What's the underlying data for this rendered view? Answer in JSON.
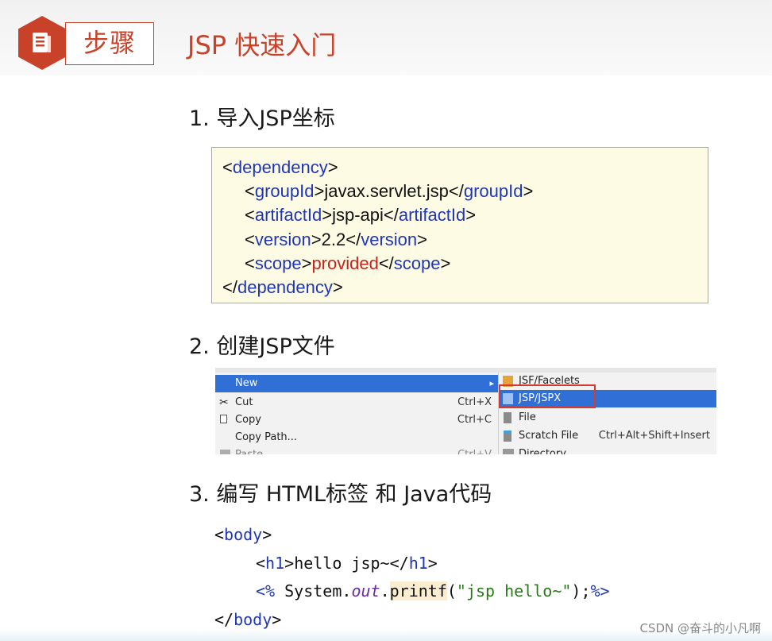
{
  "header": {
    "badge_label": "步骤",
    "title": "JSP 快速入门"
  },
  "steps": [
    {
      "label": "1. 导入JSP坐标"
    },
    {
      "label": "2. 创建JSP文件"
    },
    {
      "label": "3. 编写 HTML标签 和 Java代码"
    }
  ],
  "xml": {
    "dependency_tag": "dependency",
    "groupId_tag": "groupId",
    "groupId_value": "javax.servlet.jsp",
    "artifactId_tag": "artifactId",
    "artifactId_value": "jsp-api",
    "version_tag": "version",
    "version_value": "2.2",
    "scope_tag": "scope",
    "scope_value": "provided"
  },
  "menu": {
    "left_items": [
      {
        "label": "New",
        "shortcut": ""
      },
      {
        "label": "Cut",
        "shortcut": "Ctrl+X"
      },
      {
        "label": "Copy",
        "shortcut": "Ctrl+C"
      },
      {
        "label": "Copy Path...",
        "shortcut": ""
      },
      {
        "label": "Paste",
        "shortcut": "Ctrl+V"
      }
    ],
    "right_items": [
      {
        "label": "JSF/Facelets",
        "shortcut": ""
      },
      {
        "label": "JSP/JSPX",
        "shortcut": ""
      },
      {
        "label": "File",
        "shortcut": ""
      },
      {
        "label": "Scratch File",
        "shortcut": "Ctrl+Alt+Shift+Insert"
      },
      {
        "label": "Directory",
        "shortcut": ""
      }
    ],
    "arrow": "▸",
    "selected_color": "#2f6fd6",
    "highlight_color": "#d8392c"
  },
  "code": {
    "body_tag": "body",
    "h1_tag": "h1",
    "h1_text": "hello jsp~",
    "scriptlet_open": "<%",
    "scriptlet_close": "%>",
    "system": "System",
    "out": "out",
    "printf": "printf",
    "string": "\"jsp hello~\""
  },
  "watermark": "CSDN @奋斗的小凡啊",
  "colors": {
    "accent": "#c8422a",
    "xml_tag": "#1f37b5",
    "xml_value_red": "#c8231e",
    "xml_bg": "#fdfbe3"
  }
}
